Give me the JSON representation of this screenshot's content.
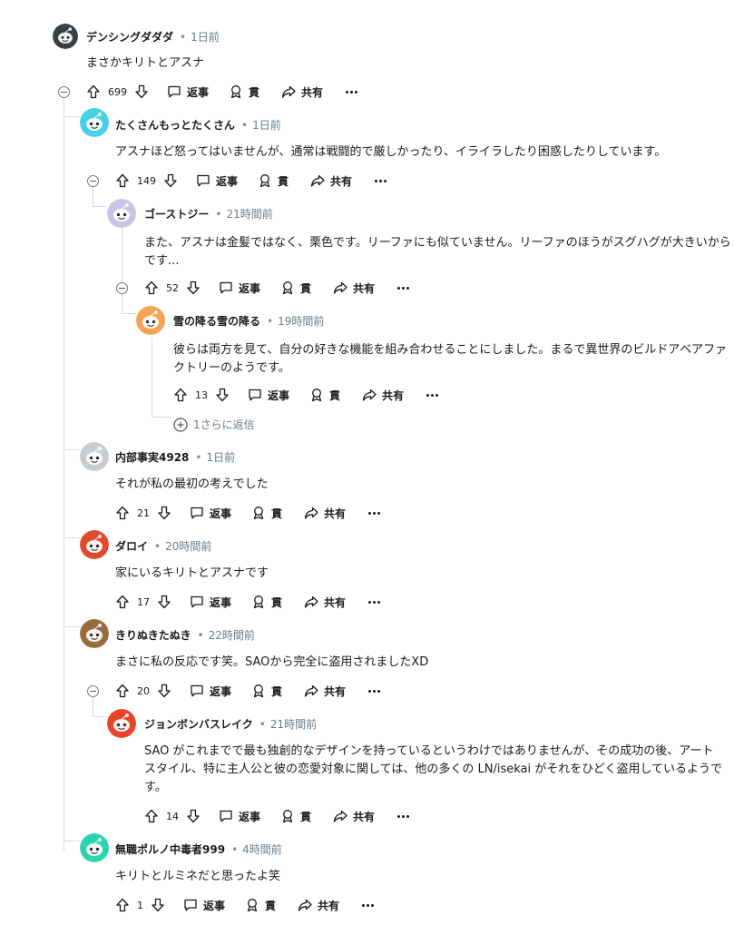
{
  "labels": {
    "reply": "返事",
    "award": "貫",
    "share": "共有",
    "more_replies": "1さらに返信"
  },
  "comments": [
    {
      "id": "c1",
      "user": "デンシングダダダ",
      "time": "1日前",
      "body": "まさかキリトとアスナ",
      "votes": "699",
      "avatar_color": "#3a3f44"
    },
    {
      "id": "c2",
      "user": "たくさんもっとたくさん",
      "time": "1日前",
      "body": "アスナほど怒ってはいませんが、通常は戦闘的で厳しかったり、イライラしたり困惑したりしています。",
      "votes": "149",
      "avatar_color": "#46d0e6"
    },
    {
      "id": "c3",
      "user": "ゴーストジー",
      "time": "21時間前",
      "body": "また、アスナは金髪ではなく、栗色です。リーファにも似ていません。リーファのほうがスグハグが大きいからです...",
      "votes": "52",
      "avatar_color": "#c9c3e8"
    },
    {
      "id": "c4",
      "user": "雪の降る雪の降る",
      "time": "19時間前",
      "body": "彼らは両方を見て、自分の好きな機能を組み合わせることにしました。まるで異世界のビルドアベアファクトリーのようです。",
      "votes": "13",
      "avatar_color": "#f5a455"
    },
    {
      "id": "c5",
      "user": "内部事実4928",
      "time": "1日前",
      "body": "それが私の最初の考えでした",
      "votes": "21",
      "avatar_color": "#c8cdd2"
    },
    {
      "id": "c6",
      "user": "ダロイ",
      "time": "20時間前",
      "body": "家にいるキリトとアスナです",
      "votes": "17",
      "avatar_color": "#e04a2e"
    },
    {
      "id": "c7",
      "user": "きりぬきたぬき",
      "time": "22時間前",
      "body": "まさに私の反応です笑。SAOから完全に盗用されましたXD",
      "votes": "20",
      "avatar_color": "#9a6b3f"
    },
    {
      "id": "c8",
      "user": "ジョンボンバスレイク",
      "time": "21時間前",
      "body": "SAO がこれまでで最も独創的なデザインを持っているというわけではありませんが、その成功の後、アートスタイル、特に主人公と彼の恋愛対象に関しては、他の多くの LN/isekai がそれをひどく盗用しているようです。",
      "votes": "14",
      "avatar_color": "#e8452b"
    },
    {
      "id": "c9",
      "user": "無職ポルノ中毒者999",
      "time": "4時間前",
      "body": "キリトとルミネだと思ったよ笑",
      "votes": "1",
      "avatar_color": "#2bd4b0"
    }
  ]
}
